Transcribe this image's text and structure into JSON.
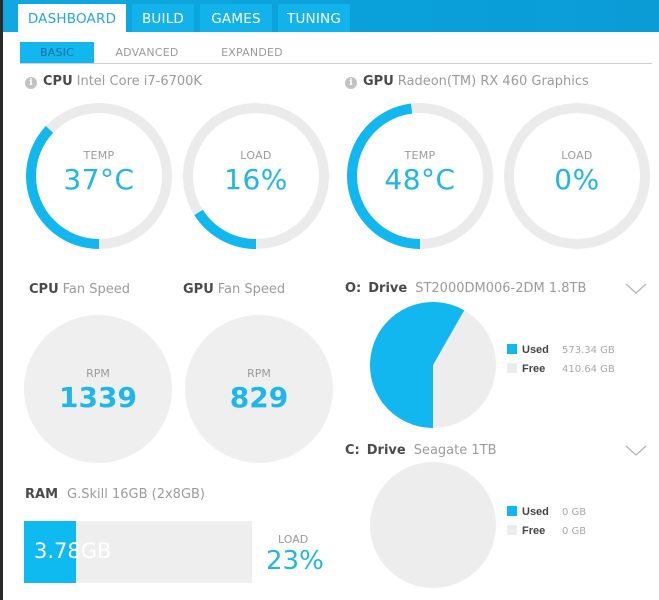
{
  "colors": {
    "accent": "#12b7ef",
    "track": "#ebebeb",
    "header_bg": "#0aa0da"
  },
  "nav": {
    "tabs": [
      {
        "label": "DASHBOARD",
        "active": true
      },
      {
        "label": "BUILD",
        "active": false
      },
      {
        "label": "GAMES",
        "active": false
      },
      {
        "label": "TUNING",
        "active": false
      }
    ],
    "subtabs": [
      {
        "label": "BASIC",
        "active": true
      },
      {
        "label": "ADVANCED",
        "active": false
      },
      {
        "label": "EXPANDED",
        "active": false
      }
    ]
  },
  "cpu": {
    "prefix": "CPU",
    "name": "Intel Core i7-6700K",
    "info_icon": "info-icon",
    "temp": {
      "label": "TEMP",
      "value": "37°C",
      "fill_percent": 37
    },
    "load": {
      "label": "LOAD",
      "value": "16%",
      "fill_percent": 16
    }
  },
  "gpu": {
    "prefix": "GPU",
    "name": "Radeon(TM) RX 460 Graphics",
    "info_icon": "info-icon",
    "temp": {
      "label": "TEMP",
      "value": "48°C",
      "fill_percent": 48
    },
    "load": {
      "label": "LOAD",
      "value": "0%",
      "fill_percent": 0
    }
  },
  "fans": {
    "cpu": {
      "prefix": "CPU",
      "title": "Fan Speed",
      "label": "RPM",
      "value": "1339"
    },
    "gpu": {
      "prefix": "GPU",
      "title": "Fan Speed",
      "label": "RPM",
      "value": "829"
    }
  },
  "drives": [
    {
      "letter": "O:",
      "prefix": "Drive",
      "name": "ST2000DM006-2DM 1.8TB",
      "used_label": "Used",
      "used_value": "573.34 GB",
      "free_label": "Free",
      "free_value": "410.64 GB",
      "used_gb": 573.34,
      "free_gb": 410.64,
      "expand_icon": "chevron-down-icon"
    },
    {
      "letter": "C:",
      "prefix": "Drive",
      "name": "Seagate 1TB",
      "used_label": "Used",
      "used_value": "0 GB",
      "free_label": "Free",
      "free_value": "0 GB",
      "used_gb": 0,
      "free_gb": 0,
      "expand_icon": "chevron-down-icon"
    }
  ],
  "ram": {
    "prefix": "RAM",
    "name": "G.Skill 16GB (2x8GB)",
    "used_text": "3.78GB",
    "load_label": "LOAD",
    "load_value": "23%",
    "fill_percent": 23
  }
}
